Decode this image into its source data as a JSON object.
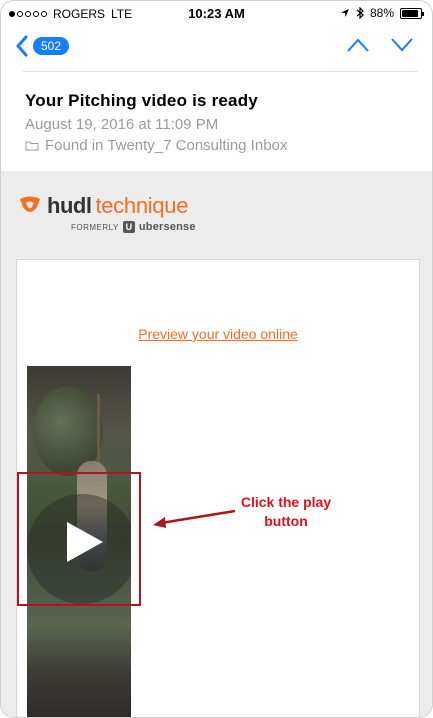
{
  "status_bar": {
    "carrier": "ROGERS",
    "network": "LTE",
    "time": "10:23 AM",
    "battery": "88%",
    "battery_level": 0.88
  },
  "nav": {
    "unread_count": "502"
  },
  "message": {
    "subject": "Your Pitching video is ready",
    "date": "August 19, 2016 at 11:09 PM",
    "found_in": "Found in Twenty_7 Consulting Inbox"
  },
  "email_body": {
    "logo": {
      "brand_bold": "hudl",
      "brand_light": "technique",
      "formerly": "FORMERLY",
      "u_mark": "U",
      "former_name": "ubersense"
    },
    "preview_link": "Preview your video online"
  },
  "annotation": {
    "callout": "Click the play button",
    "color": "#e0101a"
  },
  "colors": {
    "accent_blue": "#147efb",
    "brand_orange": "#f36f21"
  }
}
